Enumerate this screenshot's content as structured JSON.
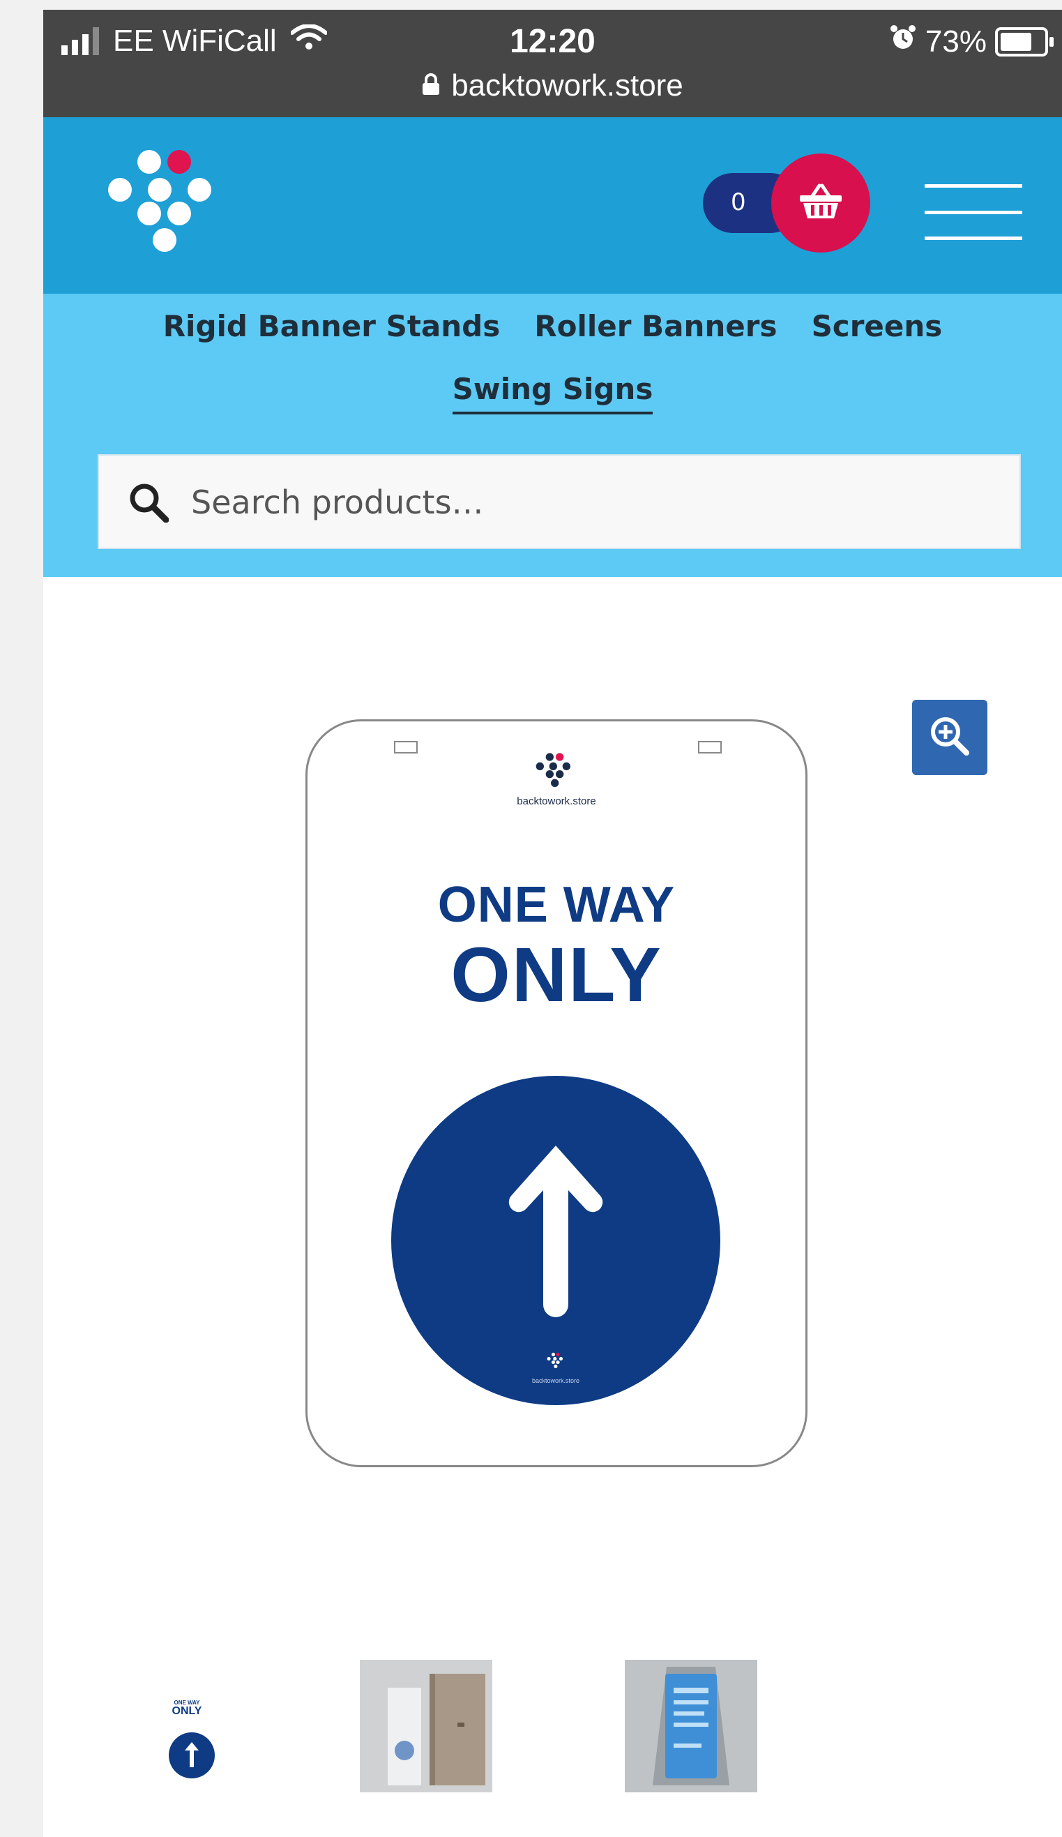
{
  "status_bar": {
    "carrier": "EE WiFiCall",
    "time": "12:20",
    "battery": "73%",
    "battery_level": 0.73,
    "url": "backtowork.store"
  },
  "header": {
    "cart_count": "0",
    "brand_color": "#1e9fd6",
    "cart_color": "#d8104e"
  },
  "nav": {
    "items": [
      {
        "label": "Rigid Banner Stands"
      },
      {
        "label": "Roller Banners"
      },
      {
        "label": "Screens"
      },
      {
        "label": "Swing Signs",
        "active": true
      }
    ]
  },
  "search": {
    "placeholder": "Search products…"
  },
  "product": {
    "sign_site": "backtowork.store",
    "sign_line1": "ONE WAY",
    "sign_line2": "ONLY",
    "sign_circle_site": "backtowork.store",
    "sign_color": "#0e3b84"
  },
  "thumbnails": {
    "first_small": "ONE WAY",
    "first_big": "ONLY"
  }
}
